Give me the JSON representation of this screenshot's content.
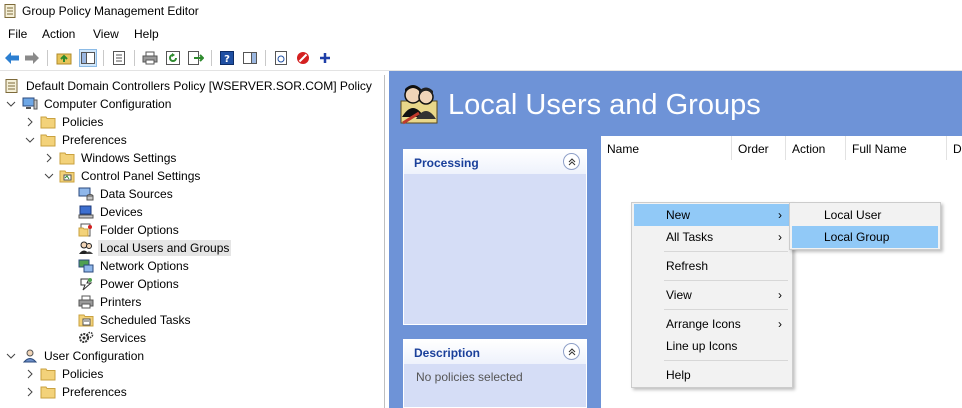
{
  "window": {
    "title": "Group Policy Management Editor"
  },
  "menu": [
    "File",
    "Action",
    "View",
    "Help"
  ],
  "toolbar": {
    "icons": [
      "back-arrow-icon",
      "forward-arrow-icon",
      "up-folder-icon",
      "show-hide-tree-icon",
      "properties-icon",
      "print-icon",
      "refresh-icon",
      "export-list-icon",
      "help-icon",
      "show-action-pane-icon",
      "new-page-icon",
      "stop-icon",
      "add-icon"
    ]
  },
  "tree": {
    "root": "Default Domain Controllers Policy [WSERVER.SOR.COM] Policy",
    "computer_configuration": "Computer Configuration",
    "policies": "Policies",
    "preferences": "Preferences",
    "windows_settings": "Windows Settings",
    "control_panel_settings": "Control Panel Settings",
    "data_sources": "Data Sources",
    "devices": "Devices",
    "folder_options": "Folder Options",
    "local_users_and_groups": "Local Users and Groups",
    "network_options": "Network Options",
    "power_options": "Power Options",
    "printers": "Printers",
    "scheduled_tasks": "Scheduled Tasks",
    "services": "Services",
    "user_configuration": "User Configuration",
    "user_policies": "Policies",
    "user_preferences": "Preferences"
  },
  "main": {
    "banner_title": "Local Users and Groups",
    "processing_label": "Processing",
    "description_label": "Description",
    "description_text": "No policies selected",
    "columns": [
      "Name",
      "Order",
      "Action",
      "Full Name",
      "De"
    ]
  },
  "context_menu": {
    "items": {
      "new": "New",
      "all_tasks": "All Tasks",
      "refresh": "Refresh",
      "view": "View",
      "arrange_icons": "Arrange Icons",
      "line_up_icons": "Line up Icons",
      "help": "Help"
    },
    "arrow": "›"
  },
  "submenu": {
    "local_user": "Local User",
    "local_group": "Local Group"
  },
  "colors": {
    "banner_bg": "#6e93d7",
    "panel_bg": "#d5ddf6",
    "panel_title": "#1a3f9a",
    "menu_highlight": "#91c9f7"
  }
}
